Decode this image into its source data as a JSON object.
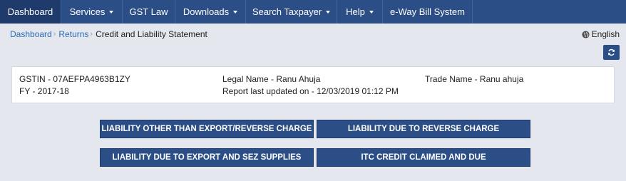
{
  "nav": {
    "items": [
      {
        "label": "Dashboard",
        "caret": false
      },
      {
        "label": "Services",
        "caret": true
      },
      {
        "label": "GST Law",
        "caret": false
      },
      {
        "label": "Downloads",
        "caret": true
      },
      {
        "label": "Search Taxpayer",
        "caret": true
      },
      {
        "label": "Help",
        "caret": true
      },
      {
        "label": "e-Way Bill System",
        "caret": false
      }
    ]
  },
  "breadcrumb": {
    "dashboard": "Dashboard",
    "returns": "Returns",
    "current": "Credit and Liability Statement"
  },
  "language": {
    "label": "English",
    "icon": "globe-icon"
  },
  "refresh": {
    "icon": "refresh-icon"
  },
  "info": {
    "gstin": "GSTIN - 07AEFPA4963B1ZY",
    "fy": "FY - 2017-18",
    "legal_name": "Legal Name - Ranu Ahuja",
    "report_updated": "Report last updated on - 12/03/2019 01:12 PM",
    "trade_name": "Trade Name - Ranu ahuja"
  },
  "buttons": {
    "liability_other": "LIABILITY OTHER THAN EXPORT/REVERSE CHARGE",
    "liability_reverse": "LIABILITY DUE TO REVERSE CHARGE",
    "liability_export": "LIABILITY DUE TO EXPORT AND SEZ SUPPLIES",
    "itc_credit": "ITC CREDIT CLAIMED AND DUE"
  },
  "colors": {
    "navbar": "#2c4e86",
    "nav_active": "#1f3b6b",
    "page_bg": "#e4e8ee",
    "link": "#2c69b4"
  }
}
